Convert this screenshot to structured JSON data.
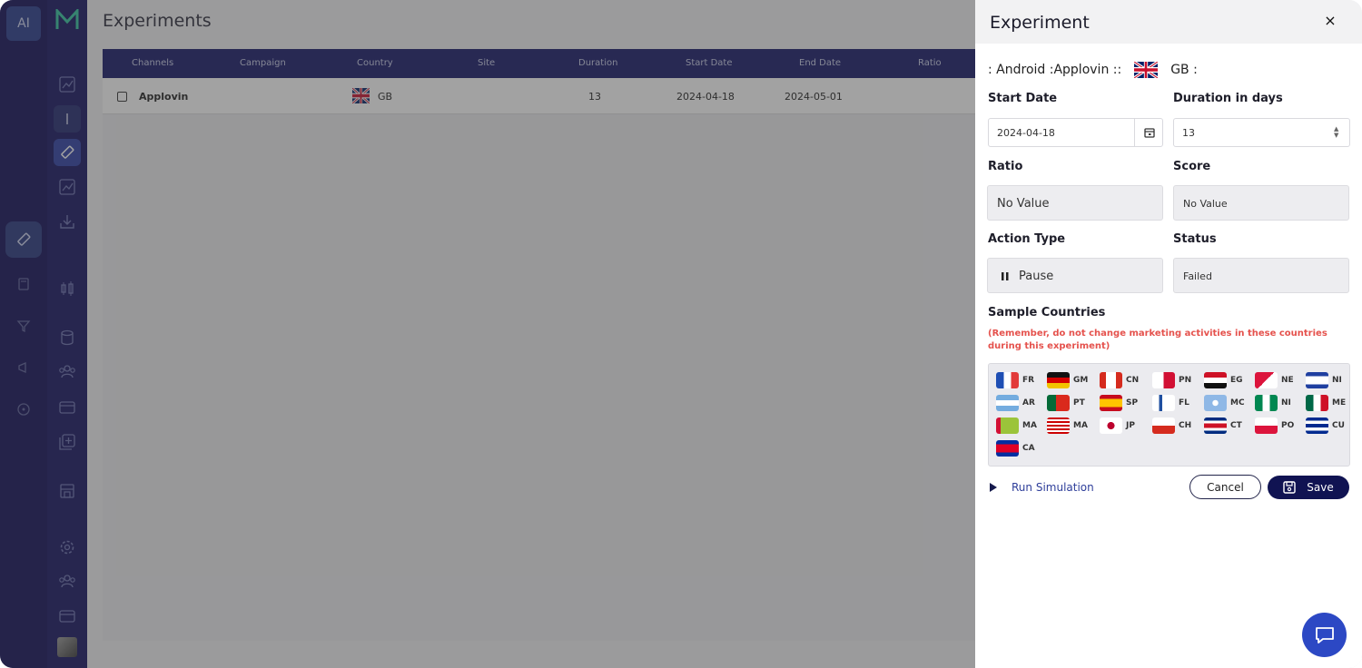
{
  "rail": {
    "ai_label": "AI"
  },
  "main": {
    "title": "Experiments",
    "columns": [
      "Channels",
      "Campaign",
      "Country",
      "Site",
      "Duration",
      "Start Date",
      "End Date",
      "Ratio"
    ],
    "rows": [
      {
        "channel": "Applovin",
        "campaign": "",
        "country": "GB",
        "site": "",
        "duration": "13",
        "start_date": "2024-04-18",
        "end_date": "2024-05-01",
        "ratio": ""
      }
    ]
  },
  "panel": {
    "title": "Experiment",
    "close": "×",
    "summary_prefix": ": Android :Applovin ::",
    "summary_country": "GB :",
    "start_date_label": "Start Date",
    "start_date_value": "2024-04-18",
    "duration_label": "Duration in days",
    "duration_value": "13",
    "ratio_label": "Ratio",
    "ratio_value": "No Value",
    "score_label": "Score",
    "score_value": "No Value",
    "action_type_label": "Action Type",
    "action_type_value": "Pause",
    "status_label": "Status",
    "status_value": "Failed",
    "sample_countries_label": "Sample Countries",
    "warning": "(Remember, do not change marketing activities in these countries during this experiment)",
    "countries": [
      [
        "FR",
        "GM",
        "CN",
        "PN",
        "EG",
        "NE",
        "NI"
      ],
      [
        "AR",
        "PT",
        "SP",
        "FL",
        "MC",
        "NI",
        "ME"
      ],
      [
        "MA",
        "MA",
        "JP",
        "CH",
        "CT",
        "PO",
        "CU"
      ],
      [
        "CA"
      ]
    ],
    "run_simulation": "Run Simulation",
    "cancel": "Cancel",
    "save": "Save"
  }
}
